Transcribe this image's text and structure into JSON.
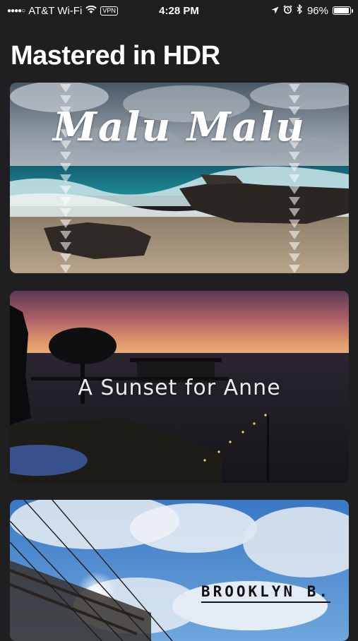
{
  "status_bar": {
    "carrier": "AT&T Wi-Fi",
    "vpn": "VPN",
    "time": "4:28 PM",
    "battery": "96%",
    "battery_level": 0.96,
    "icons": [
      "signal-icon",
      "wifi-icon",
      "location-icon",
      "alarm-icon",
      "bluetooth-icon",
      "battery-icon"
    ]
  },
  "page": {
    "title": "Mastered in HDR"
  },
  "videos": [
    {
      "title": "Malu Malu"
    },
    {
      "title": "A Sunset for Anne"
    },
    {
      "title": "BROOKLYN B."
    }
  ]
}
